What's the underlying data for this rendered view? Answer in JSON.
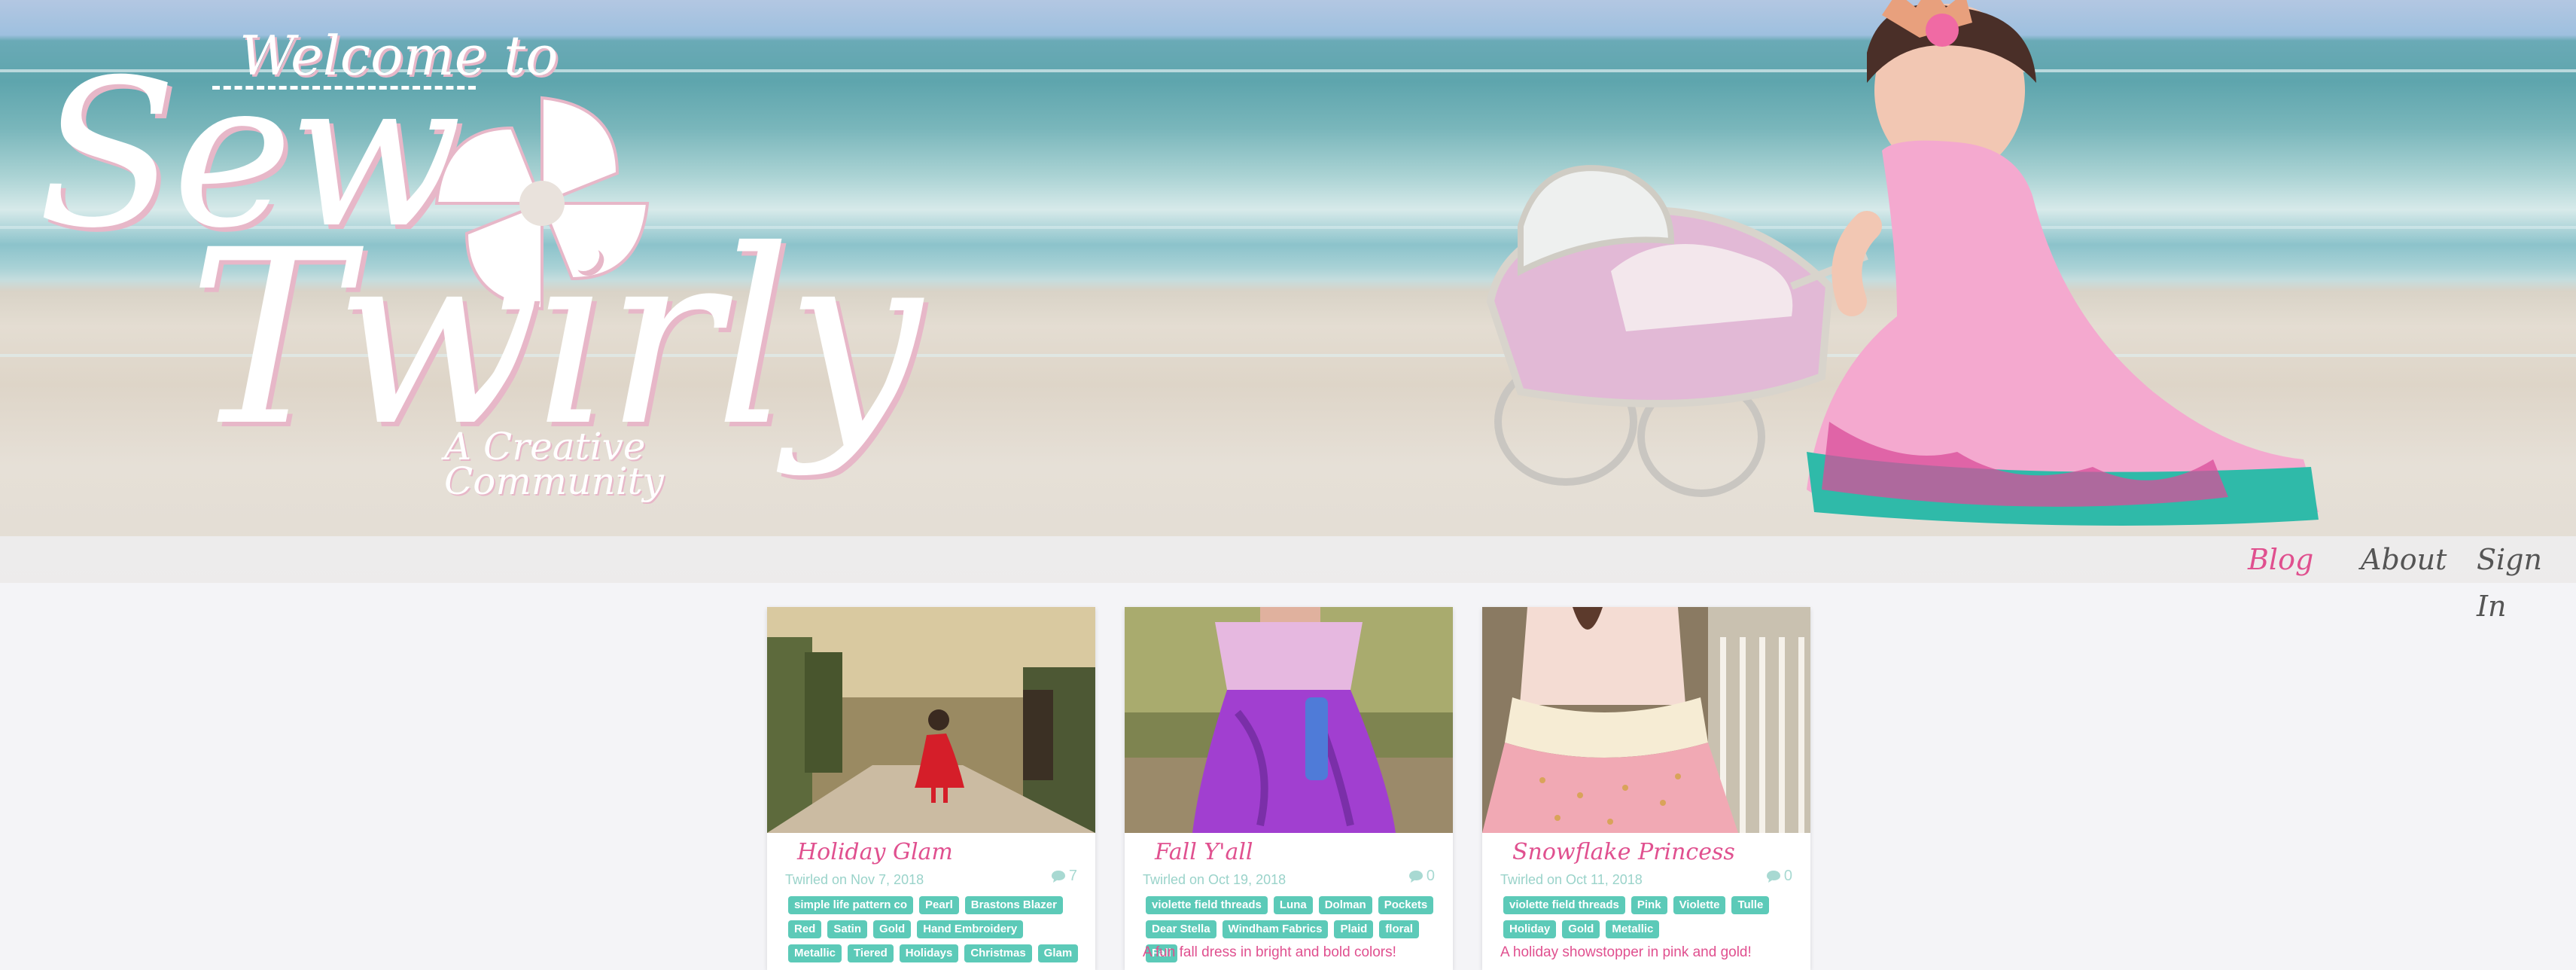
{
  "header": {
    "logo": {
      "welcome_text": "Welcome to",
      "title_line1": "Sew",
      "title_line2": "Twirly",
      "tagline_line1": "A Creative",
      "tagline_line2": "Community"
    },
    "nav": [
      {
        "label": "Blog",
        "active": true
      },
      {
        "label": "About",
        "active": false
      },
      {
        "label": "Sign In",
        "active": false
      }
    ]
  },
  "posts": [
    {
      "title": "Holiday Glam",
      "date": "Twirled on Nov 7, 2018",
      "comments": "7",
      "tags": [
        "simple life pattern co",
        "Pearl",
        "Brastons Blazer",
        "Red",
        "Satin",
        "Gold",
        "Hand Embroidery",
        "Metallic",
        "Tiered",
        "Holidays",
        "Christmas",
        "Glam"
      ],
      "description": ""
    },
    {
      "title": "Fall Y'all",
      "date": "Twirled on Oct 19, 2018",
      "comments": "0",
      "tags": [
        "violette field threads",
        "Luna",
        "Dolman",
        "Pockets",
        "Dear Stella",
        "Windham Fabrics",
        "Plaid",
        "floral",
        "Fall"
      ],
      "description": "A fun fall dress in bright and bold colors!"
    },
    {
      "title": "Snowflake Princess",
      "date": "Twirled on Oct 11, 2018",
      "comments": "0",
      "tags": [
        "violette field threads",
        "Pink",
        "Violette",
        "Tulle",
        "Holiday",
        "Gold",
        "Metallic"
      ],
      "description": "A holiday showstopper in pink and gold!"
    }
  ],
  "colors": {
    "accent_pink": "#e0508f",
    "tag_teal": "#5ccab8",
    "date_teal": "#9ad3ca"
  }
}
